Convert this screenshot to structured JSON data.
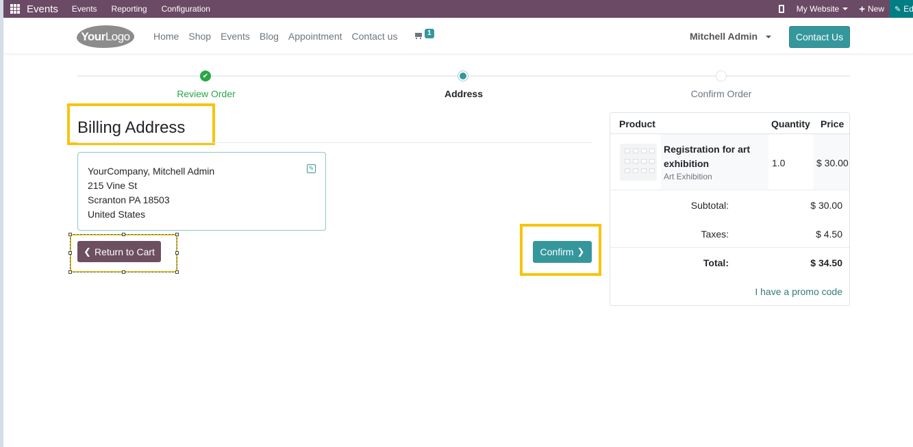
{
  "topbar": {
    "app_icon": "apps-grid-icon",
    "app_name": "Events",
    "menus": [
      "Events",
      "Reporting",
      "Configuration"
    ],
    "mobile_icon": "mobile-icon",
    "website_selector": "My Website",
    "new_label": "New",
    "edit_label": "Ed"
  },
  "header": {
    "logo_bold": "Your",
    "logo_light": "Logo",
    "nav": [
      "Home",
      "Shop",
      "Events",
      "Blog",
      "Appointment",
      "Contact us"
    ],
    "cart_count": "1",
    "user_name": "Mitchell Admin",
    "contact_button": "Contact Us"
  },
  "wizard": {
    "steps": [
      {
        "label": "Review Order",
        "state": "done"
      },
      {
        "label": "Address",
        "state": "active"
      },
      {
        "label": "Confirm Order",
        "state": "todo"
      }
    ],
    "check_glyph": "✔"
  },
  "billing": {
    "title": "Billing Address",
    "address_lines": [
      "YourCompany, Mitchell Admin",
      "215 Vine St",
      "Scranton PA 18503",
      "United States"
    ],
    "edit_glyph": "✎"
  },
  "actions": {
    "return_label": "Return to Cart",
    "confirm_label": "Confirm",
    "chev_left": "❮",
    "chev_right": "❯"
  },
  "summary": {
    "headers": {
      "product": "Product",
      "quantity": "Quantity",
      "price": "Price"
    },
    "lines": [
      {
        "name": "Registration for art exhibition",
        "subtitle": "Art Exhibition",
        "quantity": "1.0",
        "price": "$ 30.00"
      }
    ],
    "subtotal_label": "Subtotal:",
    "subtotal": "$ 30.00",
    "taxes_label": "Taxes:",
    "taxes": "$ 4.50",
    "total_label": "Total:",
    "total": "$ 34.50",
    "promo_link": "I have a promo code"
  },
  "colors": {
    "topbar": "#6b4a66",
    "primary": "#35979c",
    "secondary_button": "#6d5060",
    "success": "#28a745",
    "highlight": "#f9c30c"
  }
}
